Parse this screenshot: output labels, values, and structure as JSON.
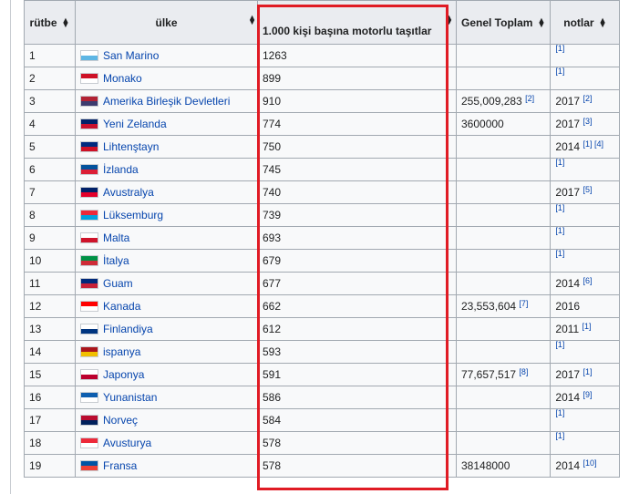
{
  "headers": {
    "rank": "rütbe",
    "country": "ülke",
    "vehicles": "1.000 kişi başına motorlu taşıtlar",
    "total": "Genel Toplam",
    "notes": "notlar"
  },
  "sort_icon": "sort-arrows",
  "highlight_color": "#e01b24",
  "rows": [
    {
      "rank": "1",
      "country": "San Marino",
      "vehicles": "1263",
      "total": "",
      "total_ref": "",
      "year": "",
      "refs": "[1]",
      "flag": [
        "#fff",
        "#5eb6e4"
      ]
    },
    {
      "rank": "2",
      "country": "Monako",
      "vehicles": "899",
      "total": "",
      "total_ref": "",
      "year": "",
      "refs": "[1]",
      "flag": [
        "#ce1126",
        "#fff"
      ]
    },
    {
      "rank": "3",
      "country": "Amerika Birleşik Devletleri",
      "vehicles": "910",
      "total": "255,009,283",
      "total_ref": "[2]",
      "year": "2017",
      "refs": "[2]",
      "flag": [
        "#b22234",
        "#3c3b6e"
      ]
    },
    {
      "rank": "4",
      "country": "Yeni Zelanda",
      "vehicles": "774",
      "total": "3600000",
      "total_ref": "",
      "year": "2017",
      "refs": "[3]",
      "flag": [
        "#012169",
        "#c8102e"
      ]
    },
    {
      "rank": "5",
      "country": "Lihtenştayn",
      "vehicles": "750",
      "total": "",
      "total_ref": "",
      "year": "2014",
      "refs": "[1] [4]",
      "flag": [
        "#002b7f",
        "#ce1126"
      ]
    },
    {
      "rank": "6",
      "country": "İzlanda",
      "vehicles": "745",
      "total": "",
      "total_ref": "",
      "year": "",
      "refs": "[1]",
      "flag": [
        "#02529c",
        "#dc1e35"
      ]
    },
    {
      "rank": "7",
      "country": "Avustralya",
      "vehicles": "740",
      "total": "",
      "total_ref": "",
      "year": "2017",
      "refs": "[5]",
      "flag": [
        "#012169",
        "#e4002b"
      ]
    },
    {
      "rank": "8",
      "country": "Lüksemburg",
      "vehicles": "739",
      "total": "",
      "total_ref": "",
      "year": "",
      "refs": "[1]",
      "flag": [
        "#ed2939",
        "#00a1de"
      ]
    },
    {
      "rank": "9",
      "country": "Malta",
      "vehicles": "693",
      "total": "",
      "total_ref": "",
      "year": "",
      "refs": "[1]",
      "flag": [
        "#fff",
        "#cf142b"
      ]
    },
    {
      "rank": "10",
      "country": "İtalya",
      "vehicles": "679",
      "total": "",
      "total_ref": "",
      "year": "",
      "refs": "[1]",
      "flag": [
        "#009246",
        "#ce2b37"
      ]
    },
    {
      "rank": "11",
      "country": "Guam",
      "vehicles": "677",
      "total": "",
      "total_ref": "",
      "year": "2014",
      "refs": "[6]",
      "flag": [
        "#00297b",
        "#c62139"
      ]
    },
    {
      "rank": "12",
      "country": "Kanada",
      "vehicles": "662",
      "total": "23,553,604",
      "total_ref": "[7]",
      "year": "2016",
      "refs": "",
      "flag": [
        "#ff0000",
        "#fff"
      ]
    },
    {
      "rank": "13",
      "country": "Finlandiya",
      "vehicles": "612",
      "total": "",
      "total_ref": "",
      "year": "2011",
      "refs": "[1]",
      "flag": [
        "#fff",
        "#003580"
      ]
    },
    {
      "rank": "14",
      "country": "ispanya",
      "vehicles": "593",
      "total": "",
      "total_ref": "",
      "year": "",
      "refs": "[1]",
      "flag": [
        "#aa151b",
        "#f1bf00"
      ]
    },
    {
      "rank": "15",
      "country": "Japonya",
      "vehicles": "591",
      "total": "77,657,517",
      "total_ref": "[8]",
      "year": "2017",
      "refs": "[1]",
      "flag": [
        "#fff",
        "#bc002d"
      ]
    },
    {
      "rank": "16",
      "country": "Yunanistan",
      "vehicles": "586",
      "total": "",
      "total_ref": "",
      "year": "2014",
      "refs": "[9]",
      "flag": [
        "#0d5eaf",
        "#fff"
      ]
    },
    {
      "rank": "17",
      "country": "Norveç",
      "vehicles": "584",
      "total": "",
      "total_ref": "",
      "year": "",
      "refs": "[1]",
      "flag": [
        "#ba0c2f",
        "#00205b"
      ]
    },
    {
      "rank": "18",
      "country": "Avusturya",
      "vehicles": "578",
      "total": "",
      "total_ref": "",
      "year": "",
      "refs": "[1]",
      "flag": [
        "#ed2939",
        "#fff"
      ]
    },
    {
      "rank": "19",
      "country": "Fransa",
      "vehicles": "578",
      "total": "38148000",
      "total_ref": "",
      "year": "2014",
      "refs": "[10]",
      "flag": [
        "#0055a4",
        "#ef4135"
      ]
    }
  ]
}
